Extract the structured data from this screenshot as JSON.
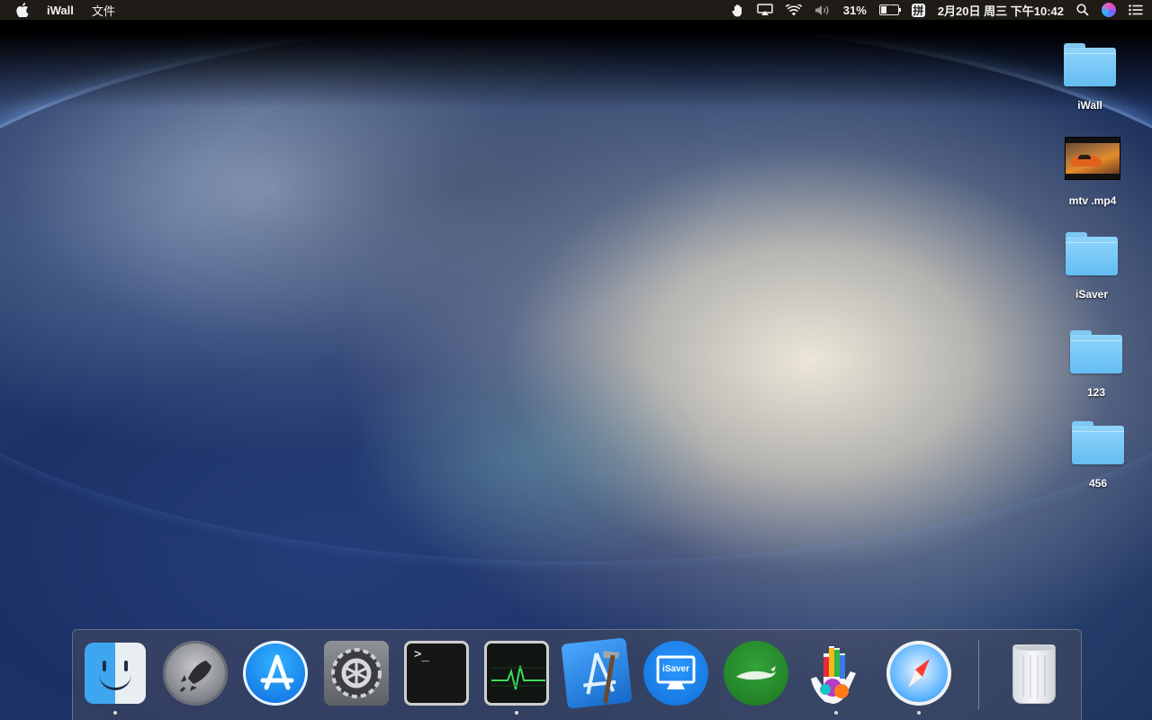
{
  "menubar": {
    "apple_icon": "apple-icon",
    "app_name": "iWall",
    "menu_file": "文件",
    "status": {
      "battery_percent": "31%",
      "battery_level": 0.31,
      "ime": "拼",
      "datetime": "2月20日 周三 下午10:42"
    }
  },
  "desktop": {
    "items": [
      {
        "label": "iWall",
        "icon": "folder-icon"
      },
      {
        "label": "mtv .mp4",
        "icon": "video-thumbnail"
      },
      {
        "label": "iSaver",
        "icon": "folder-icon"
      },
      {
        "label": "123",
        "icon": "folder-icon"
      },
      {
        "label": "456",
        "icon": "folder-icon"
      }
    ]
  },
  "dock": {
    "apps": [
      {
        "name": "Finder",
        "icon": "finder-icon",
        "running": true
      },
      {
        "name": "Launchpad",
        "icon": "rocket-icon",
        "running": false
      },
      {
        "name": "App Store",
        "icon": "app-store-icon",
        "running": false
      },
      {
        "name": "System Preferences",
        "icon": "gear-icon",
        "running": false
      },
      {
        "name": "Terminal",
        "icon": "terminal-icon",
        "running": false
      },
      {
        "name": "Activity Monitor",
        "icon": "activity-monitor-icon",
        "running": true
      },
      {
        "name": "Xcode",
        "icon": "xcode-icon",
        "running": false
      },
      {
        "name": "iSaver",
        "icon": "isaver-icon",
        "label": "iSaver",
        "running": false
      },
      {
        "name": "Green App",
        "icon": "whale-icon",
        "running": false
      },
      {
        "name": "Hand Paint App",
        "icon": "painted-hand-icon",
        "running": true
      },
      {
        "name": "Safari",
        "icon": "safari-icon",
        "running": true
      },
      {
        "name": "Trash",
        "icon": "trash-icon",
        "running": false
      }
    ],
    "terminal_prompt": ">_",
    "isaver_label": "iSaver"
  },
  "colors": {
    "menubar_bg": "#28221e",
    "folder_blue": "#63bdf2",
    "isaver_blue": "#1577e0",
    "green_app": "#1f7d24"
  }
}
